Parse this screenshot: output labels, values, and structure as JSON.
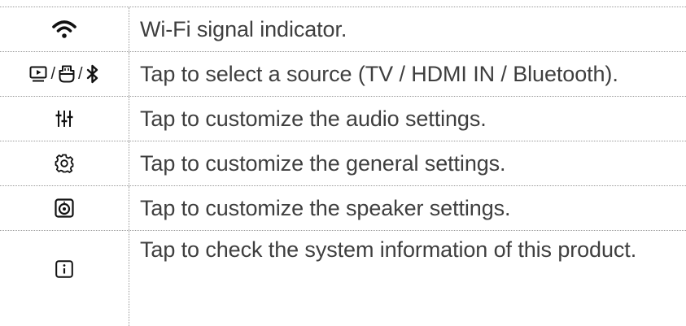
{
  "rows": [
    {
      "icon": "wifi-icon",
      "description": "Wi-Fi signal indicator."
    },
    {
      "icons": [
        "tv-icon",
        "hdmi-icon",
        "bluetooth-icon"
      ],
      "separator": "/",
      "description": "Tap to select a source (TV / HDMI IN / Bluetooth)."
    },
    {
      "icon": "equalizer-icon",
      "description": "Tap to customize the audio settings."
    },
    {
      "icon": "gear-icon",
      "description": "Tap to customize the general settings."
    },
    {
      "icon": "speaker-icon",
      "description": "Tap to customize the speaker settings."
    },
    {
      "icon": "info-icon",
      "description": "Tap to check the system information of this product."
    }
  ]
}
